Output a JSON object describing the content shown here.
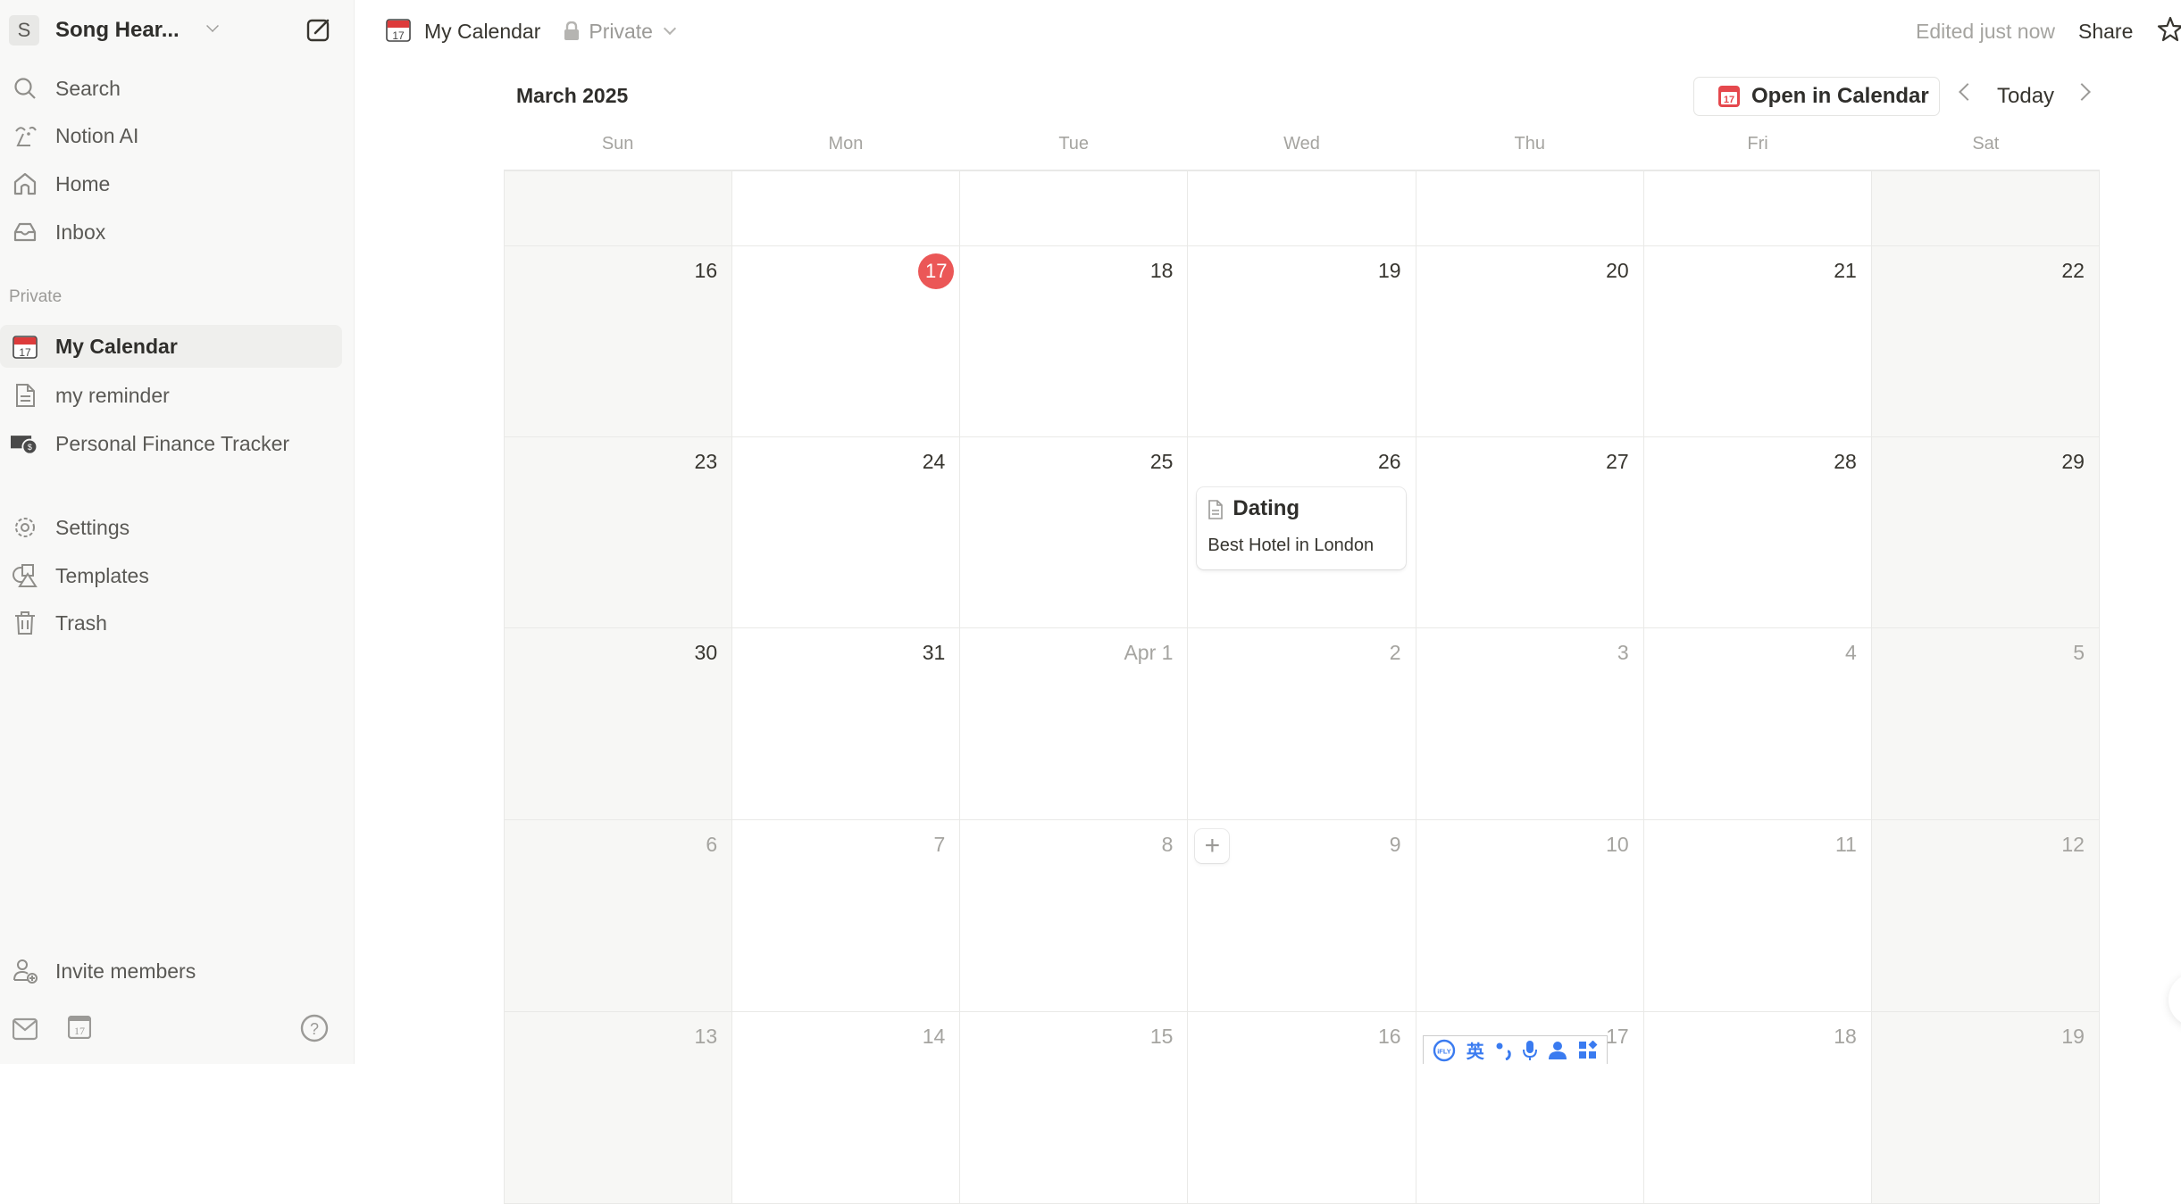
{
  "workspace": {
    "avatar_letter": "S",
    "name": "Song Hear..."
  },
  "sidebar": {
    "top_items": [
      {
        "label": "Search",
        "icon": "search-icon"
      },
      {
        "label": "Notion AI",
        "icon": "notion-ai-icon"
      },
      {
        "label": "Home",
        "icon": "home-icon"
      },
      {
        "label": "Inbox",
        "icon": "inbox-icon"
      }
    ],
    "section_label": "Private",
    "private_items": [
      {
        "label": "My Calendar",
        "icon": "calendar-emoji-icon",
        "selected": true
      },
      {
        "label": "my reminder",
        "icon": "page-icon"
      },
      {
        "label": "Personal Finance Tracker",
        "icon": "money-icon"
      }
    ],
    "utility_items": [
      {
        "label": "Settings",
        "icon": "gear-icon"
      },
      {
        "label": "Templates",
        "icon": "templates-icon"
      },
      {
        "label": "Trash",
        "icon": "trash-icon"
      }
    ],
    "invite_label": "Invite members",
    "footer_icons": [
      "mail-icon",
      "calendar-icon",
      "help-icon"
    ]
  },
  "topbar": {
    "page_title": "My Calendar",
    "privacy": "Private",
    "edited": "Edited just now",
    "share": "Share"
  },
  "calendar": {
    "month_label": "March 2025",
    "open_button": "Open in Calendar",
    "today_button": "Today",
    "calendar_badge": "17",
    "weekdays": [
      "Sun",
      "Mon",
      "Tue",
      "Wed",
      "Thu",
      "Fri",
      "Sat"
    ],
    "today_date": "17",
    "weeks": [
      [
        {
          "d": ""
        },
        {
          "d": ""
        },
        {
          "d": ""
        },
        {
          "d": ""
        },
        {
          "d": ""
        },
        {
          "d": ""
        },
        {
          "d": ""
        }
      ],
      [
        {
          "d": "16"
        },
        {
          "d": "17",
          "today": true
        },
        {
          "d": "18"
        },
        {
          "d": "19"
        },
        {
          "d": "20"
        },
        {
          "d": "21"
        },
        {
          "d": "22"
        }
      ],
      [
        {
          "d": "23"
        },
        {
          "d": "24"
        },
        {
          "d": "25"
        },
        {
          "d": "26"
        },
        {
          "d": "27"
        },
        {
          "d": "28"
        },
        {
          "d": "29"
        }
      ],
      [
        {
          "d": "30"
        },
        {
          "d": "31"
        },
        {
          "d": "Apr 1",
          "muted": true
        },
        {
          "d": "2",
          "muted": true
        },
        {
          "d": "3",
          "muted": true
        },
        {
          "d": "4",
          "muted": true
        },
        {
          "d": "5",
          "muted": true
        }
      ],
      [
        {
          "d": "6",
          "muted": true
        },
        {
          "d": "7",
          "muted": true
        },
        {
          "d": "8",
          "muted": true
        },
        {
          "d": "9",
          "muted": true
        },
        {
          "d": "10",
          "muted": true
        },
        {
          "d": "11",
          "muted": true
        },
        {
          "d": "12",
          "muted": true
        }
      ],
      [
        {
          "d": "13",
          "muted": true
        },
        {
          "d": "14",
          "muted": true
        },
        {
          "d": "15",
          "muted": true
        },
        {
          "d": "16",
          "muted": true
        },
        {
          "d": "17",
          "muted": true
        },
        {
          "d": "18",
          "muted": true
        },
        {
          "d": "19",
          "muted": true
        }
      ]
    ],
    "event": {
      "title": "Dating",
      "subtitle": "Best Hotel in London",
      "date": "26"
    },
    "add_button": "+"
  },
  "ime_toolbar": [
    "iFLY",
    "英",
    "•,",
    "mic",
    "user",
    "apps"
  ],
  "colors": {
    "today": "#eb5757",
    "accent_ime": "#3a7bf0",
    "sidebar_bg": "#f8f8f7",
    "weekend_bg": "#f7f7f5"
  }
}
